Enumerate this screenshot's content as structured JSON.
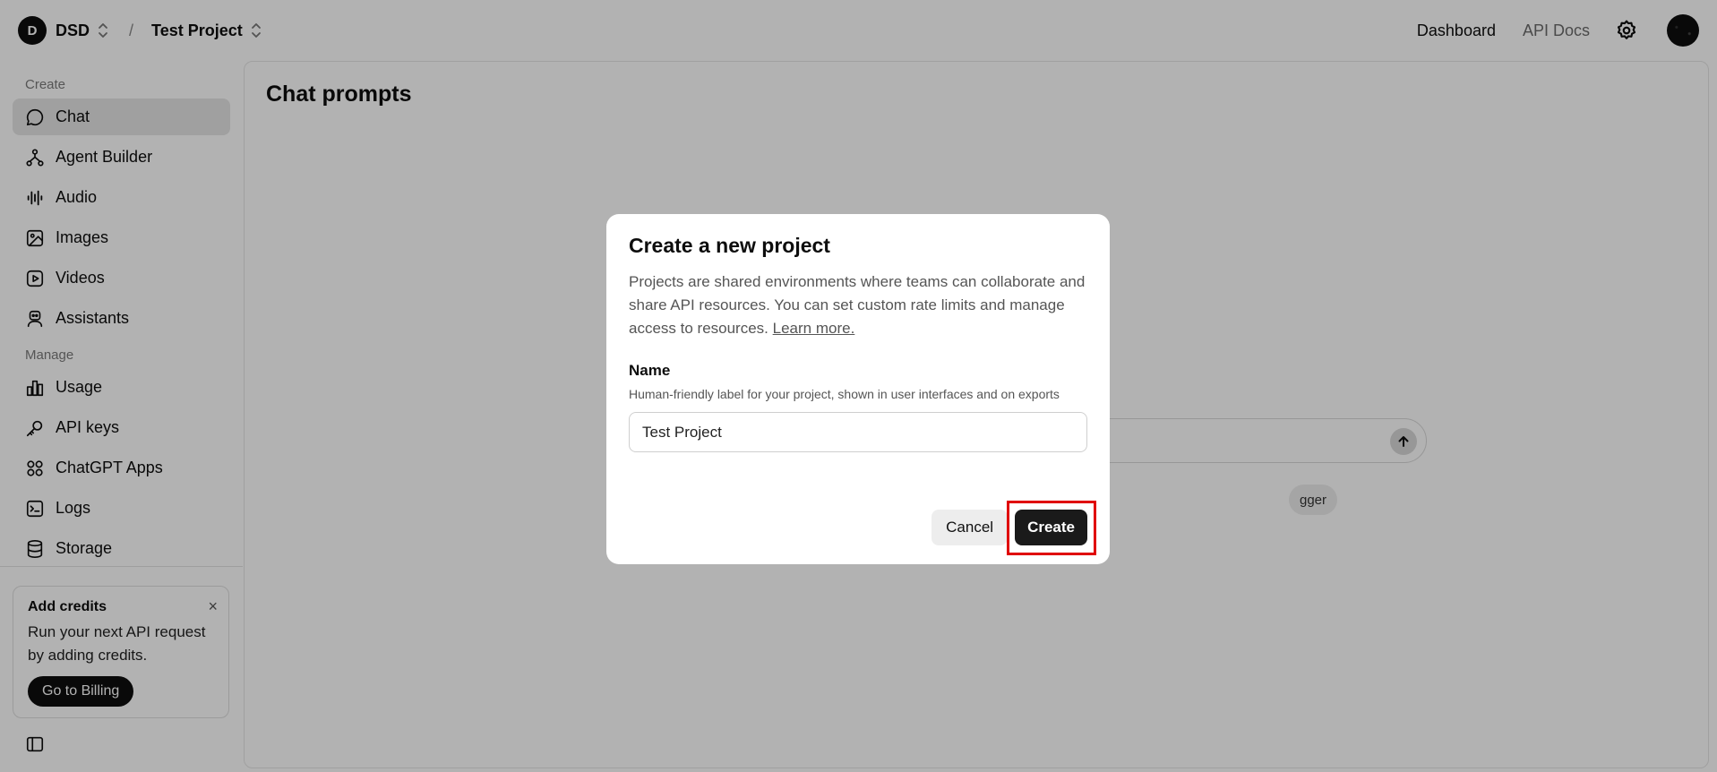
{
  "topbar": {
    "org_initial": "D",
    "org_name": "DSD",
    "separator": "/",
    "project_name": "Test Project",
    "links": {
      "dashboard": "Dashboard",
      "api_docs": "API Docs"
    }
  },
  "sidebar": {
    "create_title": "Create",
    "create_items": [
      {
        "label": "Chat",
        "icon": "chat-bubble-icon",
        "active": true
      },
      {
        "label": "Agent Builder",
        "icon": "agent-builder-icon"
      },
      {
        "label": "Audio",
        "icon": "audio-waveform-icon"
      },
      {
        "label": "Images",
        "icon": "image-icon"
      },
      {
        "label": "Videos",
        "icon": "video-play-icon"
      },
      {
        "label": "Assistants",
        "icon": "robot-icon"
      }
    ],
    "manage_title": "Manage",
    "manage_items": [
      {
        "label": "Usage",
        "icon": "bar-chart-icon"
      },
      {
        "label": "API keys",
        "icon": "key-icon"
      },
      {
        "label": "ChatGPT Apps",
        "icon": "apps-icon"
      },
      {
        "label": "Logs",
        "icon": "terminal-icon"
      },
      {
        "label": "Storage",
        "icon": "database-icon"
      }
    ],
    "credits": {
      "title": "Add credits",
      "close": "×",
      "text": "Run your next API request by adding credits.",
      "button": "Go to Billing"
    }
  },
  "main": {
    "title": "Chat prompts",
    "chip_text": "gger"
  },
  "modal": {
    "title": "Create a new project",
    "description": "Projects are shared environments where teams can collaborate and share API resources. You can set custom rate limits and manage access to resources.",
    "learn_more": "Learn more.",
    "name_label": "Name",
    "name_help": "Human-friendly label for your project, shown in user interfaces and on exports",
    "name_value": "Test Project",
    "cancel": "Cancel",
    "create": "Create"
  },
  "colors": {
    "highlight": "#e00000",
    "primary_button": "#1a1a1a"
  }
}
